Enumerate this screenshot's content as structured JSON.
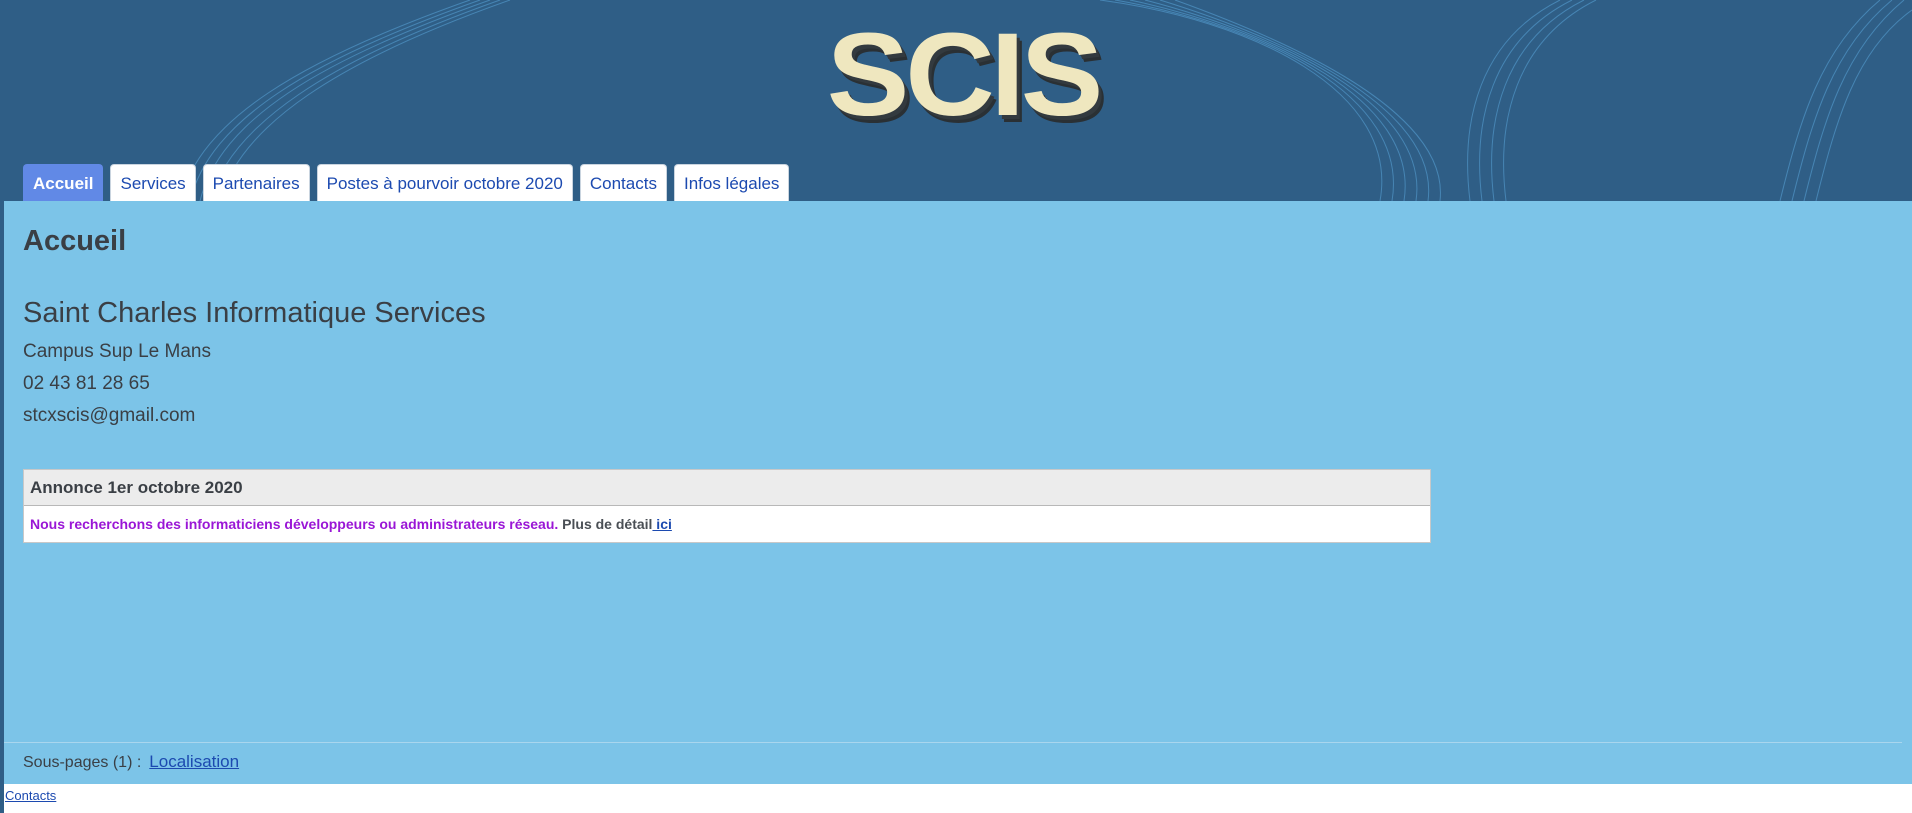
{
  "header": {
    "logo_text": "SCIS",
    "colors": {
      "banner": "#2f5e86",
      "logo_text": "#efe7bf"
    }
  },
  "nav": {
    "tabs": [
      {
        "label": "Accueil",
        "active": true
      },
      {
        "label": "Services",
        "active": false
      },
      {
        "label": "Partenaires",
        "active": false
      },
      {
        "label": "Postes à pourvoir octobre 2020",
        "active": false
      },
      {
        "label": "Contacts",
        "active": false
      },
      {
        "label": "Infos légales",
        "active": false
      }
    ],
    "colors": {
      "active_bg": "#6189e6",
      "link": "#1c4ab0"
    }
  },
  "main": {
    "title": "Accueil",
    "company_name": "Saint Charles Informatique Services",
    "address": "Campus Sup Le Mans",
    "phone": "02 43 81 28 65",
    "email": "stcxscis@gmail.com",
    "background": "#7cc4e8"
  },
  "announcement": {
    "title": "Annonce 1er octobre 2020",
    "text_highlight": "Nous recherchons des informaticiens développeurs ou administrateurs réseau.",
    "text_more": " Plus de détail",
    "link_label": " ici",
    "colors": {
      "highlight": "#9a16d6"
    }
  },
  "subpages": {
    "label": "Sous-pages (1) :",
    "link_label": "Localisation"
  },
  "footer": {
    "link_label": "Contacts"
  }
}
